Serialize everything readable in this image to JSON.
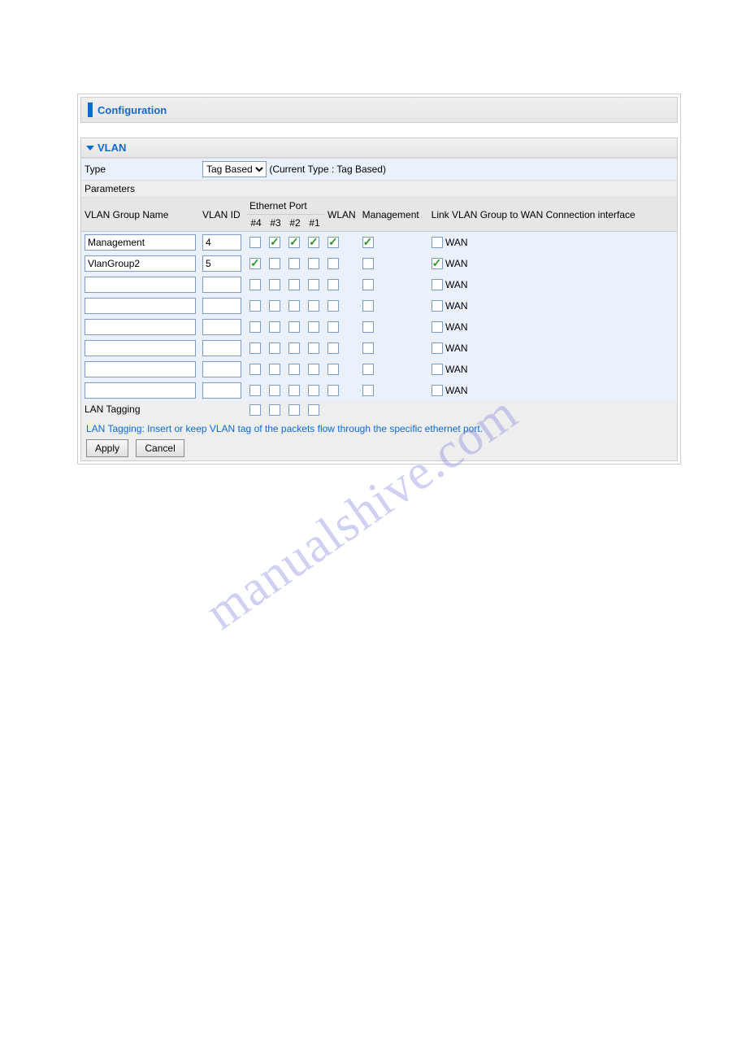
{
  "title": "Configuration",
  "section": "VLAN",
  "type": {
    "label": "Type",
    "selected": "Tag Based",
    "note": "(Current Type : Tag Based)"
  },
  "parameters_label": "Parameters",
  "headers": {
    "group_name": "VLAN Group Name",
    "vlan_id": "VLAN ID",
    "eth_port": "Ethernet Port",
    "eth4": "#4",
    "eth3": "#3",
    "eth2": "#2",
    "eth1": "#1",
    "wlan": "WLAN",
    "mgmt": "Management",
    "link": "Link VLAN Group to WAN Connection interface"
  },
  "wan_label": "WAN",
  "rows": [
    {
      "name": "Management",
      "id": "4",
      "eth": [
        false,
        true,
        true,
        true
      ],
      "wlan": true,
      "mgmt": true,
      "wan": false
    },
    {
      "name": "VlanGroup2",
      "id": "5",
      "eth": [
        true,
        false,
        false,
        false
      ],
      "wlan": false,
      "mgmt": false,
      "wan": true
    },
    {
      "name": "",
      "id": "",
      "eth": [
        false,
        false,
        false,
        false
      ],
      "wlan": false,
      "mgmt": false,
      "wan": false
    },
    {
      "name": "",
      "id": "",
      "eth": [
        false,
        false,
        false,
        false
      ],
      "wlan": false,
      "mgmt": false,
      "wan": false
    },
    {
      "name": "",
      "id": "",
      "eth": [
        false,
        false,
        false,
        false
      ],
      "wlan": false,
      "mgmt": false,
      "wan": false
    },
    {
      "name": "",
      "id": "",
      "eth": [
        false,
        false,
        false,
        false
      ],
      "wlan": false,
      "mgmt": false,
      "wan": false
    },
    {
      "name": "",
      "id": "",
      "eth": [
        false,
        false,
        false,
        false
      ],
      "wlan": false,
      "mgmt": false,
      "wan": false
    },
    {
      "name": "",
      "id": "",
      "eth": [
        false,
        false,
        false,
        false
      ],
      "wlan": false,
      "mgmt": false,
      "wan": false
    }
  ],
  "lan_tagging": {
    "label": "LAN Tagging",
    "eth": [
      false,
      false,
      false,
      false
    ]
  },
  "hint": "LAN Tagging: Insert or keep VLAN tag of the packets flow through the specific ethernet port.",
  "buttons": {
    "apply": "Apply",
    "cancel": "Cancel"
  },
  "watermark": "manualshive.com"
}
